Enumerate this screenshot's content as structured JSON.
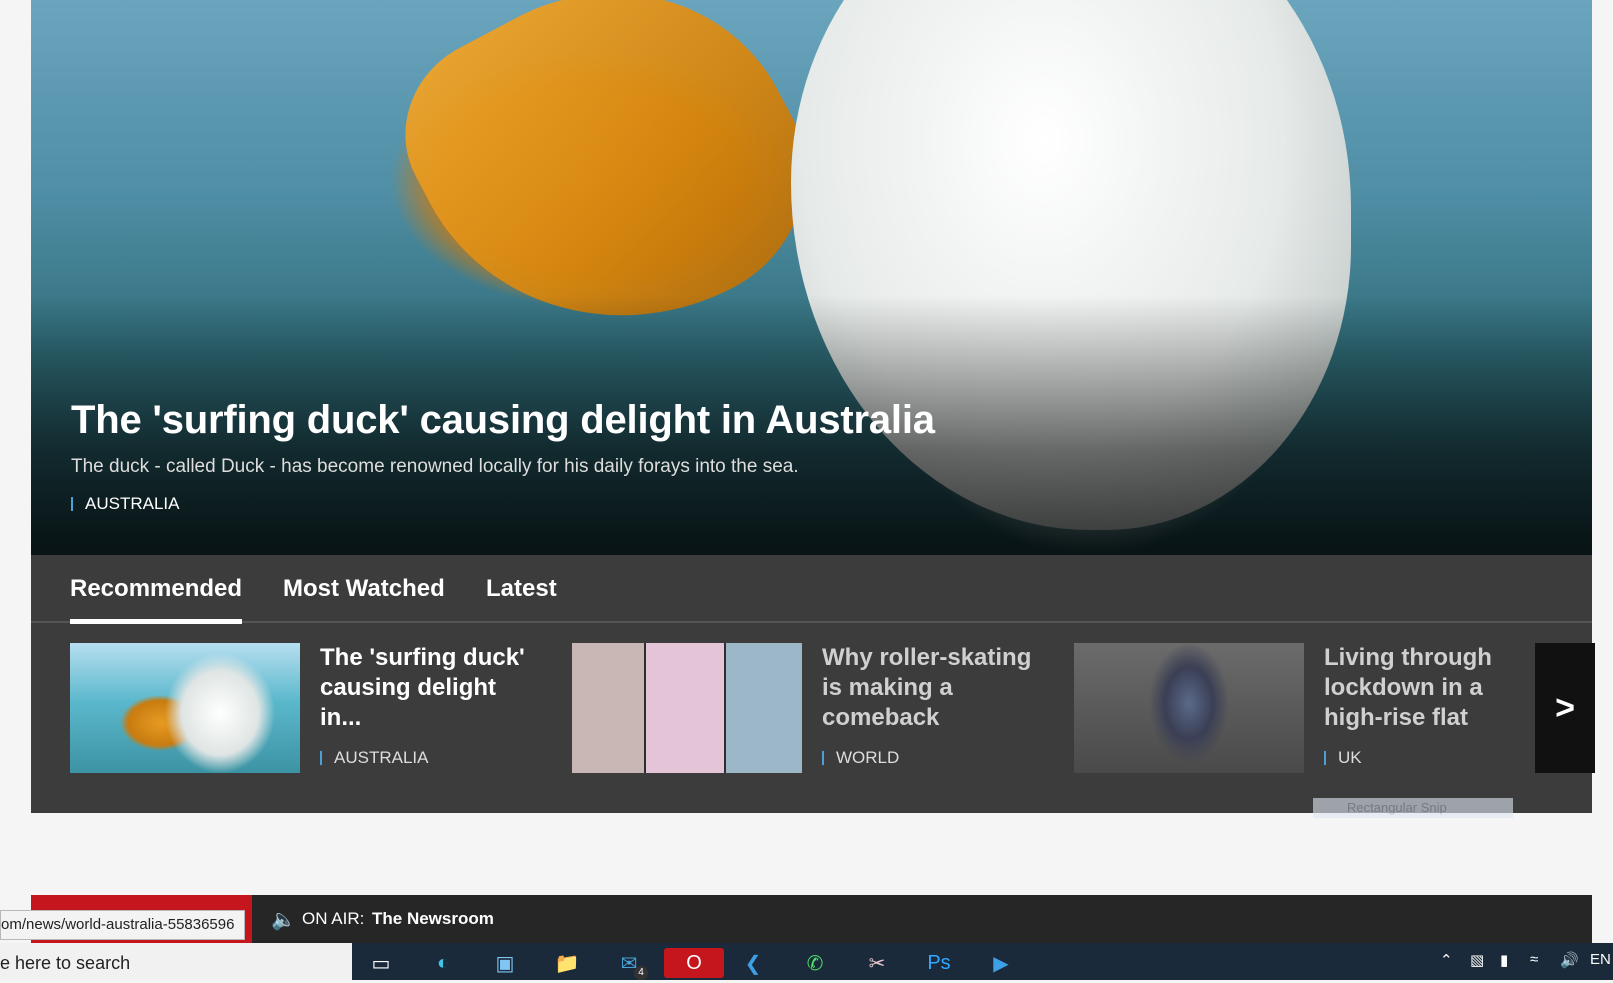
{
  "hero": {
    "title": "The 'surfing duck' causing delight in Australia",
    "summary": "The duck - called Duck - has become renowned locally for his daily forays into the sea.",
    "tag": "AUSTRALIA"
  },
  "tabs": [
    {
      "label": "Recommended",
      "active": true
    },
    {
      "label": "Most Watched",
      "active": false
    },
    {
      "label": "Latest",
      "active": false
    }
  ],
  "cards": [
    {
      "title": "The 'surfing duck' causing delight in...",
      "tag": "AUSTRALIA"
    },
    {
      "title": "Why roller-skating is making a comeback",
      "tag": "WORLD"
    },
    {
      "title": "Living through lockdown in a high-rise flat",
      "tag": "UK"
    }
  ],
  "next_label": ">",
  "snip_label": "Rectangular Snip",
  "onair": {
    "label": "ON AIR:",
    "show": "The Newsroom"
  },
  "status_url": "om/news/world-australia-55836596",
  "taskbar": {
    "search_placeholder": "e here to search",
    "mail_badge": "4",
    "language": "EN",
    "icons": [
      "task-view-icon",
      "edge-icon",
      "news-icon",
      "file-explorer-icon",
      "mail-icon",
      "opera-icon",
      "vscode-icon",
      "whatsapp-icon",
      "snip-icon",
      "photoshop-icon",
      "video-player-icon"
    ]
  },
  "colors": {
    "accent_blue": "#4aa1d6",
    "live_red": "#c4161c",
    "panel_bg": "#3c3c3c"
  }
}
